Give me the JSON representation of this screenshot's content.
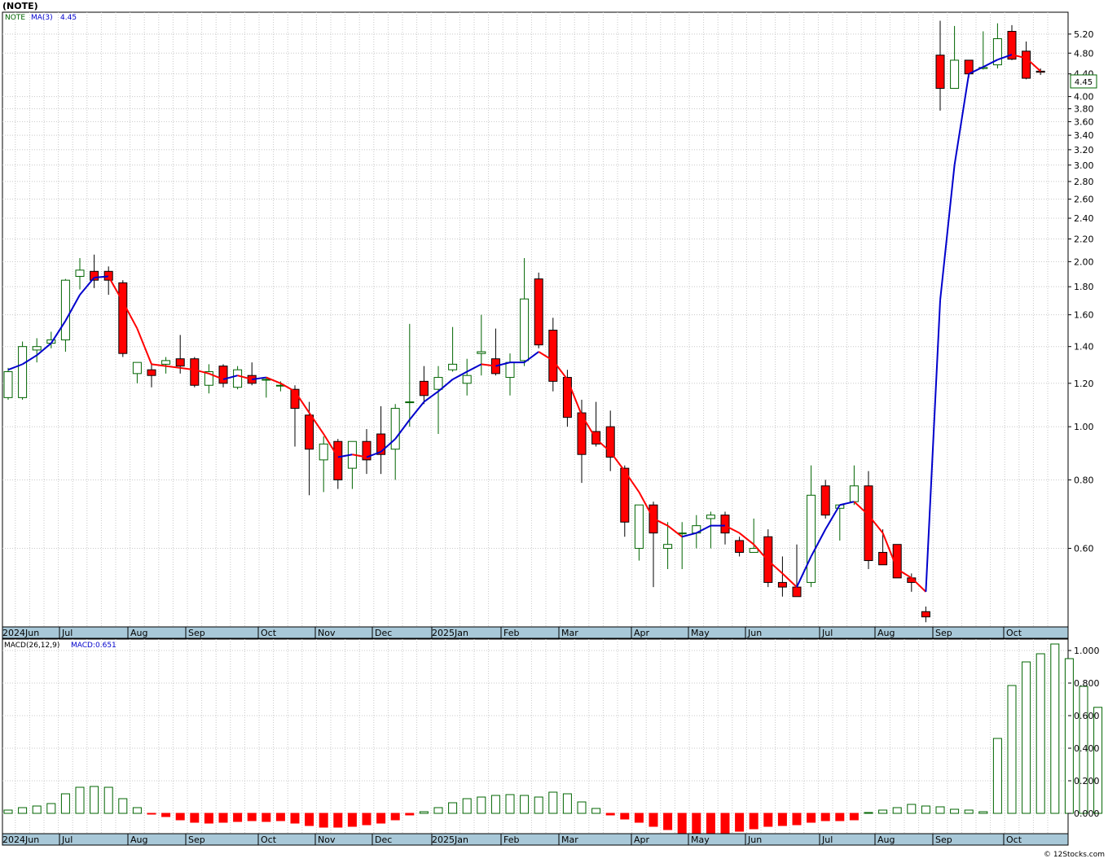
{
  "header": {
    "ticker_title": "(NOTE)",
    "price_legend_symbol": "NOTE",
    "price_legend_ma": "MA(3)",
    "price_legend_ma_value": "4.45",
    "last_price_tag": "4.45",
    "macd_legend_label": "MACD(26,12,9)",
    "macd_legend_value": "MACD:0.651",
    "watermark": "© 12Stocks.com"
  },
  "colors": {
    "up_candle": "#006400",
    "down_candle": "#ff0000",
    "ma_up": "#0000cc",
    "ma_down": "#ff0000",
    "grid": "#c8c8c8",
    "axis_band": "#a8c8d8"
  },
  "chart_data": [
    {
      "type": "candlestick",
      "name": "price",
      "scale": "log",
      "ylim": [
        0.43,
        5.7
      ],
      "yticks": [
        "5.20",
        "4.80",
        "4.40",
        "4.00",
        "3.80",
        "3.60",
        "3.40",
        "3.20",
        "3.00",
        "2.80",
        "2.60",
        "2.40",
        "2.20",
        "2.00",
        "1.80",
        "1.60",
        "1.40",
        "1.20",
        "1.00",
        "0.80",
        "0.60"
      ],
      "month_labels": [
        "2024Jun",
        "Jul",
        "Aug",
        "Sep",
        "Oct",
        "Nov",
        "Dec",
        "2025Jan",
        "Feb",
        "Mar",
        "Apr",
        "May",
        "Jun",
        "Jul",
        "Aug",
        "Sep",
        "Oct"
      ],
      "candles": [
        {
          "o": 1.13,
          "h": 1.28,
          "l": 1.12,
          "c": 1.26
        },
        {
          "o": 1.13,
          "h": 1.43,
          "l": 1.12,
          "c": 1.4
        },
        {
          "o": 1.38,
          "h": 1.45,
          "l": 1.31,
          "c": 1.4
        },
        {
          "o": 1.42,
          "h": 1.49,
          "l": 1.39,
          "c": 1.44
        },
        {
          "o": 1.44,
          "h": 1.86,
          "l": 1.37,
          "c": 1.85
        },
        {
          "o": 1.88,
          "h": 2.03,
          "l": 1.78,
          "c": 1.93
        },
        {
          "o": 1.92,
          "h": 2.06,
          "l": 1.79,
          "c": 1.85
        },
        {
          "o": 1.92,
          "h": 1.96,
          "l": 1.74,
          "c": 1.85
        },
        {
          "o": 1.83,
          "h": 1.85,
          "l": 1.34,
          "c": 1.36
        },
        {
          "o": 1.25,
          "h": 1.31,
          "l": 1.2,
          "c": 1.31
        },
        {
          "o": 1.27,
          "h": 1.3,
          "l": 1.18,
          "c": 1.24
        },
        {
          "o": 1.3,
          "h": 1.34,
          "l": 1.25,
          "c": 1.32
        },
        {
          "o": 1.33,
          "h": 1.47,
          "l": 1.25,
          "c": 1.29
        },
        {
          "o": 1.33,
          "h": 1.34,
          "l": 1.18,
          "c": 1.19
        },
        {
          "o": 1.19,
          "h": 1.3,
          "l": 1.15,
          "c": 1.26
        },
        {
          "o": 1.29,
          "h": 1.3,
          "l": 1.18,
          "c": 1.2
        },
        {
          "o": 1.18,
          "h": 1.29,
          "l": 1.17,
          "c": 1.27
        },
        {
          "o": 1.24,
          "h": 1.31,
          "l": 1.19,
          "c": 1.2
        },
        {
          "o": 1.22,
          "h": 1.23,
          "l": 1.13,
          "c": 1.22
        },
        {
          "o": 1.19,
          "h": 1.21,
          "l": 1.16,
          "c": 1.19
        },
        {
          "o": 1.17,
          "h": 1.19,
          "l": 0.92,
          "c": 1.08
        },
        {
          "o": 1.05,
          "h": 1.11,
          "l": 0.75,
          "c": 0.91
        },
        {
          "o": 0.87,
          "h": 0.96,
          "l": 0.76,
          "c": 0.93
        },
        {
          "o": 0.94,
          "h": 0.95,
          "l": 0.77,
          "c": 0.8
        },
        {
          "o": 0.84,
          "h": 0.94,
          "l": 0.77,
          "c": 0.94
        },
        {
          "o": 0.94,
          "h": 0.99,
          "l": 0.82,
          "c": 0.87
        },
        {
          "o": 0.97,
          "h": 1.09,
          "l": 0.82,
          "c": 0.89
        },
        {
          "o": 0.91,
          "h": 1.1,
          "l": 0.8,
          "c": 1.08
        },
        {
          "o": 1.11,
          "h": 1.54,
          "l": 1.0,
          "c": 1.11
        },
        {
          "o": 1.21,
          "h": 1.29,
          "l": 1.1,
          "c": 1.14
        },
        {
          "o": 1.17,
          "h": 1.29,
          "l": 0.97,
          "c": 1.23
        },
        {
          "o": 1.27,
          "h": 1.52,
          "l": 1.26,
          "c": 1.3
        },
        {
          "o": 1.2,
          "h": 1.33,
          "l": 1.14,
          "c": 1.24
        },
        {
          "o": 1.36,
          "h": 1.6,
          "l": 1.24,
          "c": 1.37
        },
        {
          "o": 1.33,
          "h": 1.51,
          "l": 1.24,
          "c": 1.25
        },
        {
          "o": 1.23,
          "h": 1.36,
          "l": 1.14,
          "c": 1.31
        },
        {
          "o": 1.32,
          "h": 2.03,
          "l": 1.29,
          "c": 1.71
        },
        {
          "o": 1.86,
          "h": 1.91,
          "l": 1.39,
          "c": 1.41
        },
        {
          "o": 1.5,
          "h": 1.58,
          "l": 1.16,
          "c": 1.21
        },
        {
          "o": 1.23,
          "h": 1.27,
          "l": 1.0,
          "c": 1.04
        },
        {
          "o": 1.06,
          "h": 1.12,
          "l": 0.79,
          "c": 0.89
        },
        {
          "o": 0.98,
          "h": 1.11,
          "l": 0.92,
          "c": 0.93
        },
        {
          "o": 1.0,
          "h": 1.07,
          "l": 0.83,
          "c": 0.88
        },
        {
          "o": 0.84,
          "h": 0.85,
          "l": 0.63,
          "c": 0.67
        },
        {
          "o": 0.6,
          "h": 0.72,
          "l": 0.57,
          "c": 0.72
        },
        {
          "o": 0.72,
          "h": 0.73,
          "l": 0.51,
          "c": 0.64
        },
        {
          "o": 0.6,
          "h": 0.67,
          "l": 0.55,
          "c": 0.61
        },
        {
          "o": 0.64,
          "h": 0.67,
          "l": 0.55,
          "c": 0.64
        },
        {
          "o": 0.64,
          "h": 0.69,
          "l": 0.6,
          "c": 0.66
        },
        {
          "o": 0.68,
          "h": 0.7,
          "l": 0.6,
          "c": 0.69
        },
        {
          "o": 0.69,
          "h": 0.7,
          "l": 0.61,
          "c": 0.64
        },
        {
          "o": 0.62,
          "h": 0.63,
          "l": 0.58,
          "c": 0.59
        },
        {
          "o": 0.59,
          "h": 0.68,
          "l": 0.59,
          "c": 0.6
        },
        {
          "o": 0.63,
          "h": 0.65,
          "l": 0.51,
          "c": 0.52
        },
        {
          "o": 0.52,
          "h": 0.58,
          "l": 0.49,
          "c": 0.51
        },
        {
          "o": 0.51,
          "h": 0.61,
          "l": 0.49,
          "c": 0.49
        },
        {
          "o": 0.52,
          "h": 0.85,
          "l": 0.51,
          "c": 0.75
        },
        {
          "o": 0.78,
          "h": 0.8,
          "l": 0.68,
          "c": 0.69
        },
        {
          "o": 0.71,
          "h": 0.72,
          "l": 0.62,
          "c": 0.72
        },
        {
          "o": 0.73,
          "h": 0.85,
          "l": 0.72,
          "c": 0.78
        },
        {
          "o": 0.78,
          "h": 0.83,
          "l": 0.55,
          "c": 0.57
        },
        {
          "o": 0.59,
          "h": 0.65,
          "l": 0.56,
          "c": 0.56
        },
        {
          "o": 0.61,
          "h": 0.61,
          "l": 0.53,
          "c": 0.53
        },
        {
          "o": 0.53,
          "h": 0.54,
          "l": 0.5,
          "c": 0.52
        },
        {
          "o": 0.46,
          "h": 0.47,
          "l": 0.44,
          "c": 0.45
        },
        {
          "o": 4.76,
          "h": 5.5,
          "l": 3.77,
          "c": 4.14
        },
        {
          "o": 4.14,
          "h": 5.38,
          "l": 4.14,
          "c": 4.66
        },
        {
          "o": 4.66,
          "h": 4.66,
          "l": 4.33,
          "c": 4.4
        },
        {
          "o": 4.5,
          "h": 5.26,
          "l": 4.48,
          "c": 4.52
        },
        {
          "o": 4.57,
          "h": 5.44,
          "l": 4.5,
          "c": 5.1
        },
        {
          "o": 5.26,
          "h": 5.4,
          "l": 4.66,
          "c": 4.68
        },
        {
          "o": 4.84,
          "h": 5.04,
          "l": 4.3,
          "c": 4.32
        },
        {
          "o": 4.45,
          "h": 4.5,
          "l": 4.38,
          "c": 4.43
        }
      ],
      "ma3": [
        1.27,
        1.3,
        1.35,
        1.42,
        1.56,
        1.74,
        1.87,
        1.88,
        1.69,
        1.51,
        1.3,
        1.29,
        1.28,
        1.27,
        1.25,
        1.22,
        1.24,
        1.22,
        1.23,
        1.2,
        1.16,
        1.06,
        0.97,
        0.88,
        0.89,
        0.88,
        0.9,
        0.95,
        1.03,
        1.11,
        1.16,
        1.22,
        1.26,
        1.3,
        1.29,
        1.31,
        1.31,
        1.37,
        1.32,
        1.22,
        1.05,
        0.95,
        0.9,
        0.83,
        0.76,
        0.68,
        0.66,
        0.63,
        0.64,
        0.66,
        0.66,
        0.64,
        0.61,
        0.57,
        0.54,
        0.51,
        0.58,
        0.65,
        0.72,
        0.73,
        0.69,
        0.64,
        0.55,
        0.53,
        0.5,
        1.7,
        3.0,
        4.4,
        4.53,
        4.67,
        4.77,
        4.7,
        4.45
      ]
    },
    {
      "type": "bar",
      "name": "MACD",
      "ylim": [
        -0.13,
        1.07
      ],
      "yticks": [
        "1.000",
        "0.800",
        "0.600",
        "0.400",
        "0.200",
        "0.000"
      ],
      "month_labels": [
        "2024Jun",
        "Jul",
        "Aug",
        "Sep",
        "Oct",
        "Nov",
        "Dec",
        "2025Jan",
        "Feb",
        "Mar",
        "Apr",
        "May",
        "Jun",
        "Jul",
        "Aug",
        "Sep",
        "Oct"
      ],
      "values": [
        0.02,
        0.035,
        0.045,
        0.06,
        0.12,
        0.16,
        0.165,
        0.16,
        0.09,
        0.035,
        -0.005,
        -0.02,
        -0.04,
        -0.055,
        -0.06,
        -0.055,
        -0.05,
        -0.045,
        -0.05,
        -0.045,
        -0.06,
        -0.075,
        -0.085,
        -0.085,
        -0.08,
        -0.07,
        -0.06,
        -0.04,
        -0.01,
        0.01,
        0.035,
        0.065,
        0.09,
        0.1,
        0.11,
        0.115,
        0.11,
        0.1,
        0.13,
        0.12,
        0.07,
        0.03,
        -0.01,
        -0.035,
        -0.055,
        -0.08,
        -0.1,
        -0.12,
        -0.125,
        -0.125,
        -0.12,
        -0.11,
        -0.095,
        -0.08,
        -0.075,
        -0.07,
        -0.055,
        -0.045,
        -0.045,
        -0.04,
        0.005,
        0.02,
        0.035,
        0.055,
        0.045,
        0.04,
        0.025,
        0.02,
        0.01,
        0.46,
        0.785,
        0.93,
        0.98,
        1.04,
        0.95,
        0.78,
        0.651
      ]
    }
  ]
}
